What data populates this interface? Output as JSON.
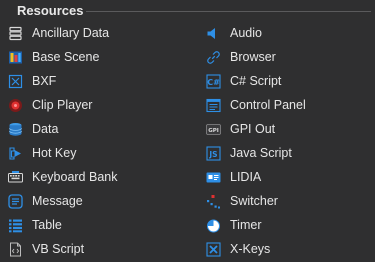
{
  "section": {
    "title": "Resources"
  },
  "left_items": [
    {
      "label": "Ancillary Data",
      "icon": "ancillary-data-icon"
    },
    {
      "label": "Base Scene",
      "icon": "base-scene-icon"
    },
    {
      "label": "BXF",
      "icon": "bxf-icon"
    },
    {
      "label": "Clip Player",
      "icon": "clip-player-icon"
    },
    {
      "label": "Data",
      "icon": "data-icon"
    },
    {
      "label": "Hot Key",
      "icon": "hot-key-icon"
    },
    {
      "label": "Keyboard Bank",
      "icon": "keyboard-bank-icon"
    },
    {
      "label": "Message",
      "icon": "message-icon"
    },
    {
      "label": "Table",
      "icon": "table-icon"
    },
    {
      "label": "VB Script",
      "icon": "vb-script-icon"
    }
  ],
  "right_items": [
    {
      "label": "Audio",
      "icon": "audio-icon"
    },
    {
      "label": "Browser",
      "icon": "browser-icon"
    },
    {
      "label": "C# Script",
      "icon": "csharp-script-icon"
    },
    {
      "label": "Control Panel",
      "icon": "control-panel-icon"
    },
    {
      "label": "GPI Out",
      "icon": "gpi-out-icon"
    },
    {
      "label": "Java Script",
      "icon": "java-script-icon"
    },
    {
      "label": "LIDIA",
      "icon": "lidia-icon"
    },
    {
      "label": "Switcher",
      "icon": "switcher-icon"
    },
    {
      "label": "Timer",
      "icon": "timer-icon"
    },
    {
      "label": "X-Keys",
      "icon": "x-keys-icon"
    }
  ],
  "colors": {
    "background": "#2f2f30",
    "text": "#e6e6e6",
    "accent_blue": "#2e8fe6",
    "accent_red": "#e03030"
  }
}
